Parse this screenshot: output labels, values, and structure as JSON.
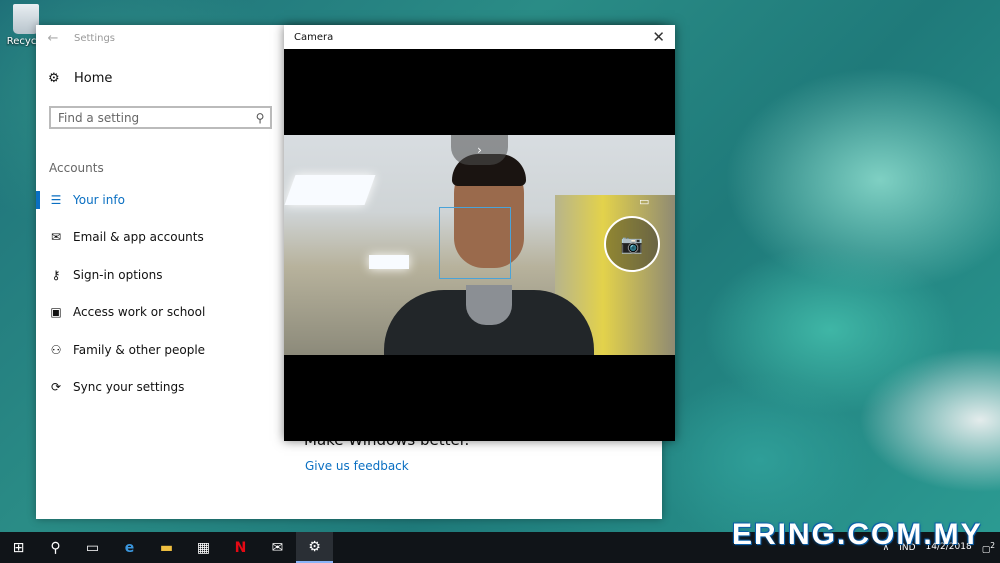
{
  "desktop": {
    "recycle_bin_label": "Recycle"
  },
  "settings": {
    "window_title": "Settings",
    "home_label": "Home",
    "search_placeholder": "Find a setting",
    "section_label": "Accounts",
    "items": [
      {
        "label": "Your info",
        "icon": "person-card-icon",
        "active": true
      },
      {
        "label": "Email & app accounts",
        "icon": "mail-icon"
      },
      {
        "label": "Sign-in options",
        "icon": "key-icon"
      },
      {
        "label": "Access work or school",
        "icon": "briefcase-icon"
      },
      {
        "label": "Family & other people",
        "icon": "people-icon"
      },
      {
        "label": "Sync your settings",
        "icon": "sync-icon"
      }
    ],
    "content": {
      "heading": "Make Windows better.",
      "feedback_link": "Give us feedback"
    }
  },
  "camera": {
    "window_title": "Camera",
    "expander_glyph": "›"
  },
  "taskbar": {
    "apps": [
      "start-icon",
      "search-icon",
      "task-view-icon",
      "edge-icon",
      "file-explorer-icon",
      "store-icon",
      "netflix-icon",
      "mail-icon",
      "settings-icon"
    ],
    "language": "IND",
    "date": "14/2/2018",
    "notifications": "2"
  },
  "watermark": "ERING.COM.MY",
  "colors": {
    "accent": "#0a6fc2",
    "taskbar": "#101418",
    "camera_bg": "#000000"
  }
}
